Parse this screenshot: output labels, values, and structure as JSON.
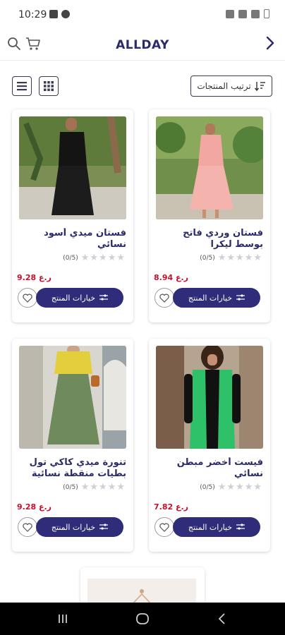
{
  "status_bar": {
    "time": "10:29"
  },
  "header": {
    "title": "ALLDAY"
  },
  "toolbar": {
    "sort_label": "ترتيب المنتجات"
  },
  "products": [
    {
      "title": "فستان وردي فاتح بوسط ليكرا",
      "rating": "(0/5)",
      "price": "8.94 ر.ع",
      "options_label": "خيارات المنتج"
    },
    {
      "title": "فستان ميدي أسود نسائي",
      "rating": "(0/5)",
      "price": "9.28 ر.ع",
      "options_label": "خيارات المنتج"
    },
    {
      "title": "فيست أخضر مبطن نسائي",
      "rating": "(0/5)",
      "price": "7.82 ر.ع",
      "options_label": "خيارات المنتج"
    },
    {
      "title": "تنورة ميدي كاكي تول بطيات منقطة نسائية",
      "rating": "(0/5)",
      "price": "9.28 ر.ع",
      "options_label": "خيارات المنتج"
    }
  ],
  "colors": {
    "brand": "#2f2c7a",
    "price": "#c8102e",
    "star_empty": "#cfcfd6"
  }
}
